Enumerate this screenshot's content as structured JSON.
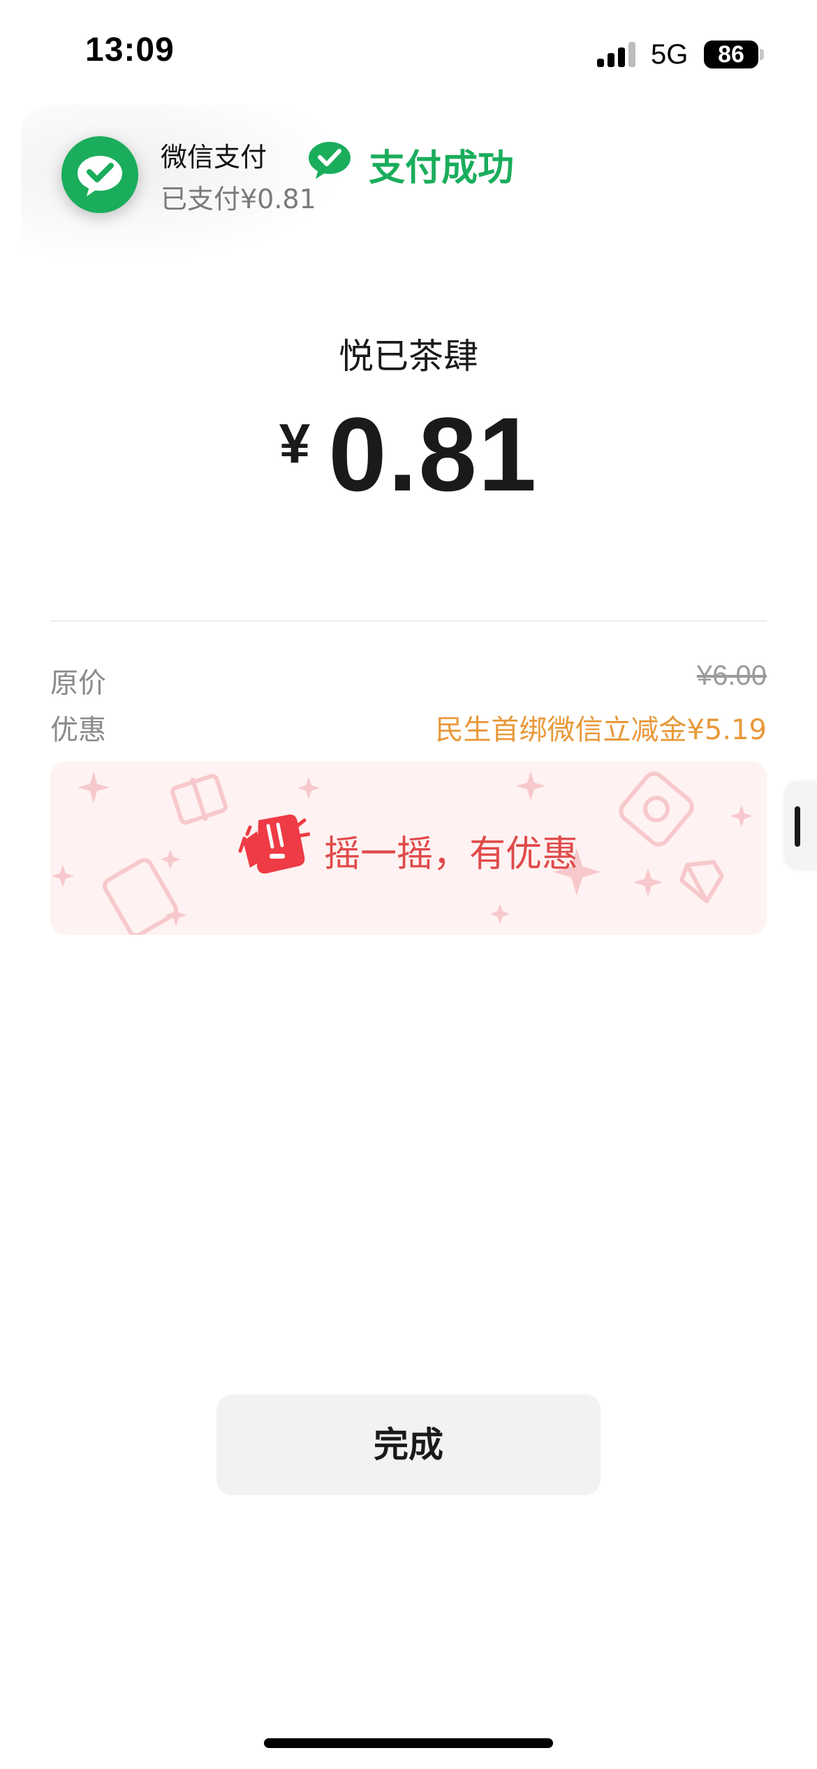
{
  "status_bar": {
    "time": "13:09",
    "network": "5G",
    "battery": "86"
  },
  "notification": {
    "app_name": "微信支付",
    "message": "已支付¥0.81",
    "icon": "wechat-pay-icon"
  },
  "header": {
    "status_text": "支付成功",
    "status_icon": "wechat-pay-check-icon",
    "accent_color": "#1aad5c"
  },
  "payment": {
    "merchant": "悦已茶肆",
    "currency": "¥",
    "amount": "0.81"
  },
  "details": [
    {
      "label": "原价",
      "value": "¥6.00"
    },
    {
      "label": "优惠",
      "value": "民生首绑微信立减金¥5.19"
    }
  ],
  "banner": {
    "text": "摇一摇，有优惠",
    "icon": "shake-hand-icon",
    "text_color": "#e04a4a",
    "background": "#fff2f2"
  },
  "actions": {
    "done_label": "完成"
  }
}
